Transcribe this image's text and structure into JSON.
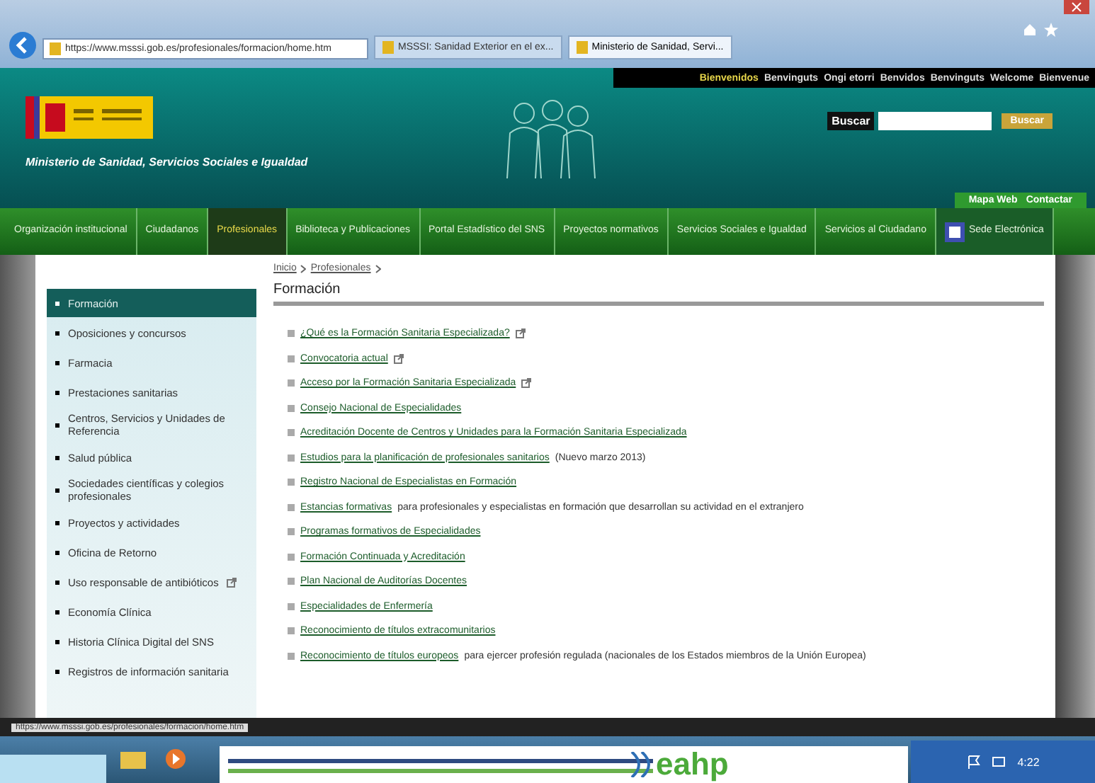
{
  "browser": {
    "address": "https://www.msssi.gob.es/profesionales/formacion/home.htm",
    "tabs": [
      {
        "label": "MSSSI: Sanidad Exterior en el ex...",
        "selected": false
      },
      {
        "label": "Ministerio de Sanidad, Servi...",
        "selected": true
      }
    ]
  },
  "site": {
    "welcome": [
      {
        "label": "Bienvenidos",
        "selected": true
      },
      {
        "label": "Benvinguts",
        "selected": false
      },
      {
        "label": "Ongi etorri",
        "selected": false
      },
      {
        "label": "Benvidos",
        "selected": false
      },
      {
        "label": "Benvinguts",
        "selected": false
      },
      {
        "label": "Welcome",
        "selected": false
      },
      {
        "label": "Bienvenue",
        "selected": false
      }
    ],
    "ministry": "Ministerio de Sanidad, Servicios Sociales e Igualdad",
    "search": {
      "label": "Buscar",
      "button": "Buscar"
    },
    "utility_links": [
      "Mapa Web",
      "Contactar"
    ],
    "nav": [
      {
        "label": "Organización institucional",
        "selected": false
      },
      {
        "label": "Ciudadanos",
        "selected": false
      },
      {
        "label": "Profesionales",
        "selected": true
      },
      {
        "label": "Biblioteca y Publicaciones",
        "selected": false
      },
      {
        "label": "Portal Estadístico del SNS",
        "selected": false
      },
      {
        "label": "Proyectos normativos",
        "selected": false
      },
      {
        "label": "Servicios Sociales e Igualdad",
        "selected": false
      },
      {
        "label": "Servicios al Ciudadano",
        "selected": false
      },
      {
        "label": "Sede Electrónica",
        "selected": false,
        "kind": "sede"
      }
    ],
    "breadcrumb": [
      "Inicio",
      "Profesionales"
    ],
    "sidebar": [
      {
        "label": "Formación",
        "selected": true,
        "external": false
      },
      {
        "label": "Oposiciones y concursos",
        "selected": false,
        "external": false
      },
      {
        "label": "Farmacia",
        "selected": false,
        "external": false
      },
      {
        "label": "Prestaciones sanitarias",
        "selected": false,
        "external": false
      },
      {
        "label": "Centros, Servicios y Unidades de Referencia",
        "selected": false,
        "external": false
      },
      {
        "label": "Salud pública",
        "selected": false,
        "external": false
      },
      {
        "label": "Sociedades científicas y colegios profesionales",
        "selected": false,
        "external": false
      },
      {
        "label": "Proyectos y actividades",
        "selected": false,
        "external": false
      },
      {
        "label": "Oficina de Retorno",
        "selected": false,
        "external": false
      },
      {
        "label": "Uso responsable de antibióticos",
        "selected": false,
        "external": true
      },
      {
        "label": "Economía Clínica",
        "selected": false,
        "external": false
      },
      {
        "label": "Historia Clínica Digital del SNS",
        "selected": false,
        "external": false
      },
      {
        "label": "Registros de información sanitaria",
        "selected": false,
        "external": false
      }
    ],
    "title": "Formación",
    "links": [
      {
        "link": "¿Qué es la Formación Sanitaria Especializada?",
        "external": true
      },
      {
        "link": "Convocatoria actual",
        "external": true
      },
      {
        "link": "Acceso por la Formación Sanitaria Especializada",
        "external": true
      },
      {
        "link": "Consejo Nacional de Especialidades",
        "external": false
      },
      {
        "link": "Acreditación Docente de Centros y Unidades para la Formación Sanitaria Especializada",
        "external": false
      },
      {
        "link": "Estudios para la planificación de profesionales sanitarios",
        "text": "(Nuevo marzo 2013)",
        "external": false
      },
      {
        "link": "Registro Nacional de Especialistas en Formación",
        "external": false
      },
      {
        "link": "Estancias formativas",
        "text": "para profesionales y especialistas en formación que desarrollan su actividad en el extranjero",
        "external": false
      },
      {
        "link": "Programas formativos de Especialidades",
        "external": false
      },
      {
        "link": "Formación Continuada y Acreditación",
        "external": false
      },
      {
        "link": "Plan Nacional de Auditorías Docentes",
        "external": false
      },
      {
        "link": "Especialidades de Enfermería",
        "external": false
      },
      {
        "link": "Reconocimiento de títulos extracomunitarios",
        "external": false
      },
      {
        "link": "Reconocimiento de títulos europeos",
        "text": "para ejercer profesión regulada (nacionales de los Estados miembros de la Unión Europea)",
        "external": false
      }
    ]
  },
  "status_url": "https://www.msssi.gob.es/profesionales/formacion/home.htm",
  "overlay_logo": "eahp",
  "taskbar": {
    "time": "4:22"
  }
}
